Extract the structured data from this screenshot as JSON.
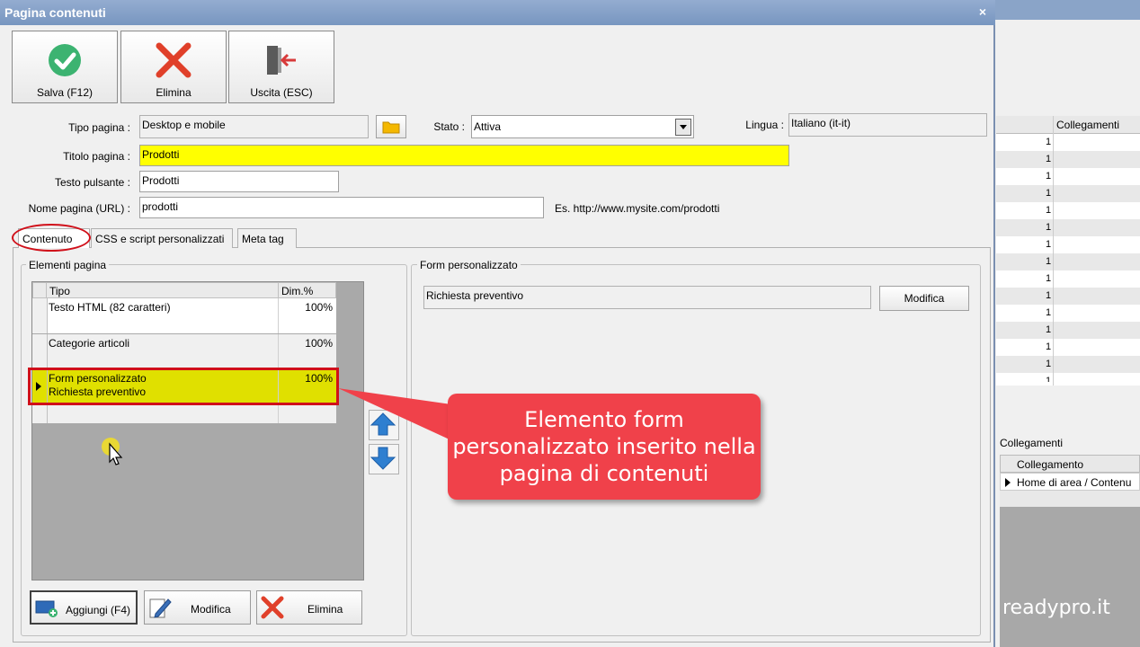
{
  "dialog": {
    "title": "Pagina contenuti",
    "close_glyph": "×"
  },
  "toolbar": {
    "save_label": "Salva (F12)",
    "delete_label": "Elimina",
    "exit_label": "Uscita (ESC)"
  },
  "form": {
    "tipo_pagina_label": "Tipo pagina :",
    "tipo_pagina_value": "Desktop e mobile",
    "stato_label": "Stato :",
    "stato_value": "Attiva",
    "lingua_label": "Lingua :",
    "lingua_value": "Italiano (it-it)",
    "titolo_label": "Titolo pagina :",
    "titolo_value": "Prodotti",
    "testo_pulsante_label": "Testo pulsante :",
    "testo_pulsante_value": "Prodotti",
    "nome_pagina_label": "Nome pagina (URL) :",
    "nome_pagina_value": "prodotti",
    "url_example": "Es. http://www.mysite.com/prodotti"
  },
  "tabs": [
    {
      "label": "Contenuto",
      "active": true
    },
    {
      "label": "CSS e script personalizzati",
      "active": false
    },
    {
      "label": "Meta tag",
      "active": false
    }
  ],
  "elementi": {
    "group_title": "Elementi pagina",
    "columns": [
      "Tipo",
      "Dim.%"
    ],
    "rows": [
      {
        "line1": "Testo HTML (82 caratteri)",
        "line2": "",
        "dim": "100%"
      },
      {
        "line1": "Categorie articoli",
        "line2": "",
        "dim": "100%"
      },
      {
        "line1": "Form personalizzato",
        "line2": "Richiesta preventivo",
        "dim": "100%"
      }
    ],
    "add_label": "Aggiungi (F4)",
    "edit_label": "Modifica",
    "delete_label": "Elimina"
  },
  "form_personalizzato": {
    "group_title": "Form personalizzato",
    "value": "Richiesta preventivo",
    "edit_label": "Modifica"
  },
  "callout": {
    "text": "Elemento form personalizzato inserito nella pagina di contenuti"
  },
  "background_window": {
    "grid_header": "Collegamenti",
    "row_value": "1",
    "group_title": "Collegamenti",
    "col_header": "Collegamento",
    "row_text": "Home di area / Contenu"
  },
  "watermark": "readypro.it",
  "colors": {
    "accent_red": "#d0101a",
    "callout": "#f0414a",
    "selected_row": "#e0e000",
    "title_field": "#ffff00"
  }
}
